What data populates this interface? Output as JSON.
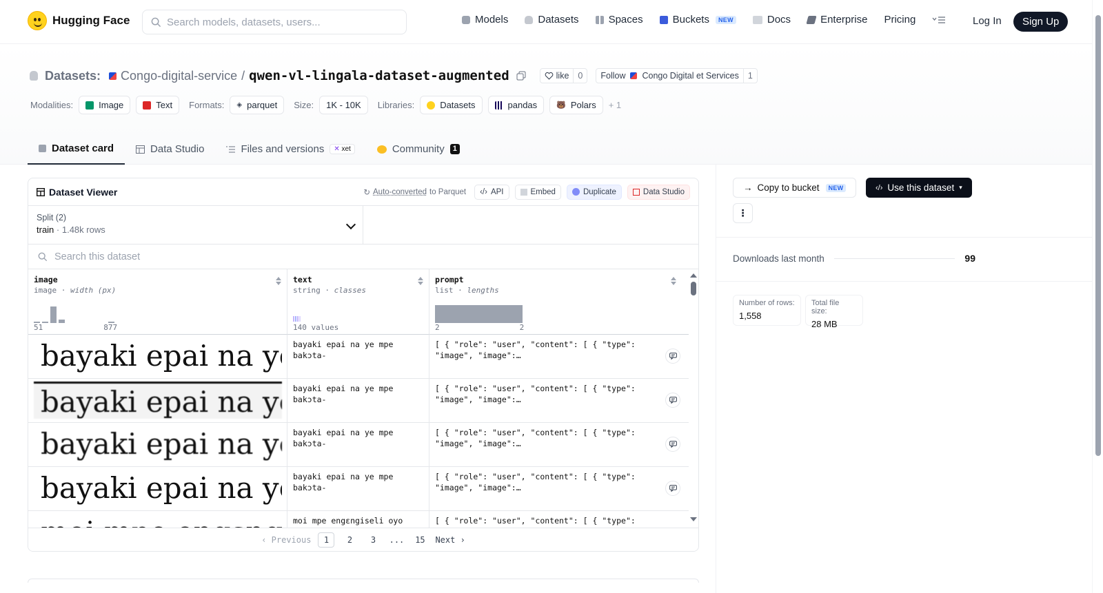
{
  "nav": {
    "brand": "Hugging Face",
    "search_placeholder": "Search models, datasets, users...",
    "links": [
      {
        "label": "Models",
        "icon": "cube-icon",
        "color": "#9ca3af"
      },
      {
        "label": "Datasets",
        "icon": "database-icon",
        "color": "#9ca3af"
      },
      {
        "label": "Spaces",
        "icon": "grid-icon",
        "color": "#9ca3af"
      },
      {
        "label": "Buckets",
        "icon": "bucket-icon",
        "color": "#3b5bdb"
      },
      {
        "label": "Docs",
        "icon": "book-icon",
        "color": "#9ca3af"
      },
      {
        "label": "Enterprise",
        "icon": "enterprise-icon",
        "color": "#6b7280"
      },
      {
        "label": "Pricing"
      }
    ],
    "buckets_badge": "NEW",
    "login": "Log In",
    "signup": "Sign Up"
  },
  "header": {
    "datasets_label": "Datasets:",
    "org": "Congo-digital-service",
    "separator": "/",
    "name": "qwen-vl-lingala-dataset-augmented",
    "like_label": "like",
    "like_count": "0",
    "follow_label": "Follow",
    "follow_org": "Congo Digital et Services",
    "follow_count": "1",
    "modalities_label": "Modalities:",
    "modalities": [
      "Image",
      "Text"
    ],
    "formats_label": "Formats:",
    "formats": [
      "parquet"
    ],
    "size_label": "Size:",
    "size": "1K - 10K",
    "libraries_label": "Libraries:",
    "libraries": [
      "Datasets",
      "pandas",
      "Polars"
    ],
    "libraries_more": "+ 1"
  },
  "tabs": [
    {
      "label": "Dataset card",
      "active": true
    },
    {
      "label": "Data Studio"
    },
    {
      "label": "Files and versions",
      "badge": "xet"
    },
    {
      "label": "Community",
      "count": "1"
    }
  ],
  "viewer": {
    "title": "Dataset Viewer",
    "auto_converted": "Auto-converted",
    "to_parquet": "to Parquet",
    "buttons": [
      "API",
      "Embed",
      "Duplicate",
      "Data Studio"
    ],
    "split_label": "Split (2)",
    "split_value": "train",
    "split_rows": "1.48k rows",
    "search_placeholder": "Search this dataset",
    "columns": [
      {
        "name": "image",
        "type": "image",
        "stat": "width (px)",
        "axis_min": "51",
        "axis_max": "877",
        "hist": [
          0.05,
          0.05,
          0.85,
          0.18,
          0,
          0,
          0,
          0,
          0,
          0.08
        ]
      },
      {
        "name": "text",
        "type": "string",
        "stat": "classes",
        "axis_min": "140 values"
      },
      {
        "name": "prompt",
        "type": "list",
        "stat": "lengths",
        "axis_min": "2",
        "axis_max": "2"
      }
    ],
    "rows": [
      {
        "image_text": "bayaki epai na ye",
        "text": "bayaki epai na ye mpe bakɔta-",
        "prompt": "[ { \"role\": \"user\", \"content\": [ { \"type\": \"image\", \"image\":…"
      },
      {
        "image_text": "bayaki epai na ye",
        "text": "bayaki epai na ye mpe bakɔta-",
        "prompt": "[ { \"role\": \"user\", \"content\": [ { \"type\": \"image\", \"image\":…"
      },
      {
        "image_text": "bayaki epai na ye",
        "text": "bayaki epai na ye mpe bakɔta-",
        "prompt": "[ { \"role\": \"user\", \"content\": [ { \"type\": \"image\", \"image\":…"
      },
      {
        "image_text": "bayaki epai na ye",
        "text": "bayaki epai na ye mpe bakɔta-",
        "prompt": "[ { \"role\": \"user\", \"content\": [ { \"type\": \"image\", \"image\":…"
      },
      {
        "image_text": "moi mpe engɛngiseli",
        "text": "moi mpe engɛngiseli oyo",
        "prompt": "[ { \"role\": \"user\", \"content\": [ { \"type\": "
      }
    ],
    "pager": {
      "prev": "Previous",
      "pages": [
        "1",
        "2",
        "3",
        "...",
        "15"
      ],
      "next": "Next"
    }
  },
  "sidebar": {
    "copy_label": "Copy to bucket",
    "copy_badge": "NEW",
    "use_label": "Use this dataset",
    "downloads_label": "Downloads last month",
    "downloads_value": "99",
    "rows_label": "Number of rows:",
    "rows_value": "1,558",
    "size_label": "Total file size:",
    "size_value": "28 MB"
  }
}
